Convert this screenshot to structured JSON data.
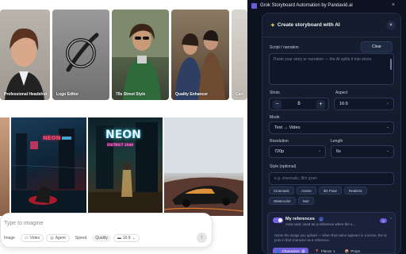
{
  "gallery": {
    "row1": [
      {
        "caption": "Professional Headshot"
      },
      {
        "caption": "Logo Editor"
      },
      {
        "caption": "70s Street Style"
      },
      {
        "caption": "Quality Enhancer"
      },
      {
        "caption": "Cart"
      }
    ],
    "neon_sign": "NEON",
    "neon_sub": "DISTRICT 2049"
  },
  "prompt_bar": {
    "placeholder": "Type to imagine",
    "chips": [
      "Image",
      "Video",
      "Agent",
      "Speed",
      "Quality",
      "16:9"
    ],
    "send_glyph": "↑"
  },
  "panel": {
    "window_title": "Grok Storyboard Automation by Pandavid.ai",
    "close_glyph": "×",
    "card": {
      "title": "Create storyboard with AI",
      "title_icon": "✦",
      "close_glyph": "×",
      "script_label": "Script / narration",
      "clear_label": "Clear",
      "script_placeholder": "Paste your story or narration — the AI splits it into shots.",
      "shots_label": "Shots",
      "shots_value": "8",
      "minus_glyph": "−",
      "plus_glyph": "+",
      "aspect_label": "Aspect",
      "aspect_value": "16:9",
      "mode_label": "Mode",
      "mode_value": "Text → Video",
      "resolution_label": "Resolution",
      "resolution_value": "720p",
      "length_label": "Length",
      "length_value": "6s",
      "style_label": "Style (optional)",
      "style_placeholder": "e.g. cinematic, film grain",
      "style_tags": [
        "Cinematic",
        "Anime",
        "3D Pixar",
        "Realistic",
        "Watercolor",
        "Noir"
      ],
      "chevron_glyph": "⌄",
      "references": {
        "title": "My references",
        "info_glyph": "i",
        "subtitle": "Auto-cast: used as a reference when the s...",
        "count": "3",
        "chevron_glyph": "⌃",
        "body": "Name the image you upload — when that name appears in a scene, the ai puts in that character as a reference.",
        "tabs": [
          {
            "label": "Characters",
            "count": "3",
            "icon": "👤"
          },
          {
            "label": "Places",
            "count": "1",
            "icon": "📍"
          },
          {
            "label": "Props",
            "count": "",
            "icon": "📦"
          }
        ]
      }
    }
  },
  "colors": {
    "panel_bg": "#0c1220",
    "card_bg": "#141c2d",
    "accent": "#6e5bd8"
  }
}
